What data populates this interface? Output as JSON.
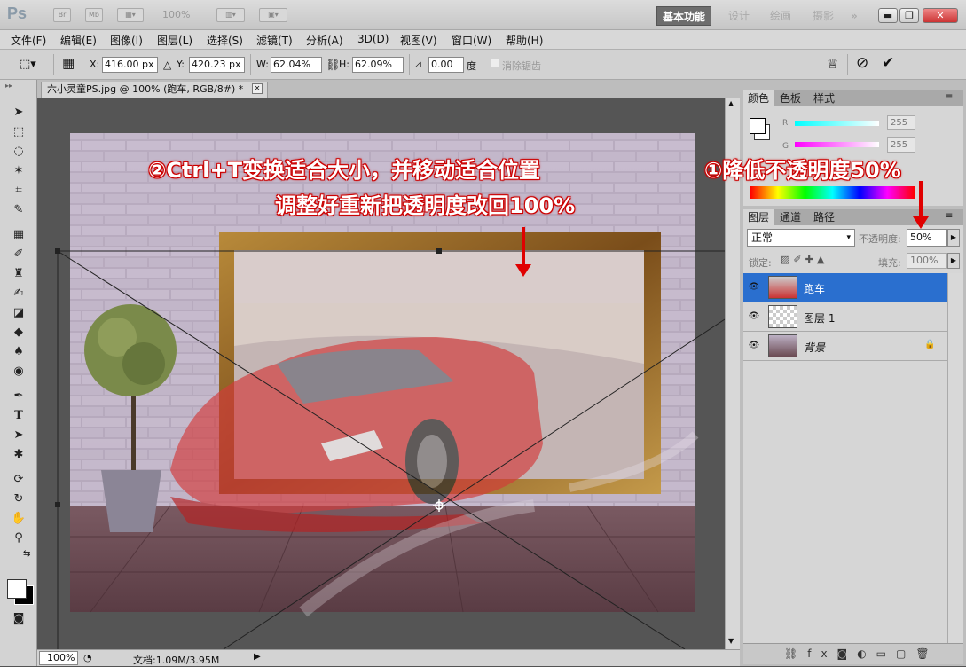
{
  "app": {
    "logo": "Ps",
    "br": "Br",
    "mb": "Mb",
    "zoom_preset": "100%"
  },
  "workspaces": [
    "基本功能",
    "设计",
    "绘画",
    "摄影",
    "»"
  ],
  "window_controls": {
    "minimize": "▬",
    "restore": "❐",
    "close": "✕"
  },
  "menus": [
    "文件(F)",
    "编辑(E)",
    "图像(I)",
    "图层(L)",
    "选择(S)",
    "滤镜(T)",
    "分析(A)",
    "3D(D)",
    "视图(V)",
    "窗口(W)",
    "帮助(H)"
  ],
  "options": {
    "x_label": "X:",
    "x_value": "416.00 px",
    "y_label": "Y:",
    "y_value": "420.23 px",
    "w_label": "W:",
    "w_value": "62.04%",
    "h_label": "H:",
    "h_value": "62.09%",
    "angle_value": "0.00",
    "angle_unit": "度",
    "antialias_label": "消除锯齿"
  },
  "document": {
    "tab_title": "六小灵童PS.jpg @ 100% (跑车, RGB/8#) *",
    "close": "✕"
  },
  "annotations": {
    "step2_line1": "②Ctrl+T变换适合大小，并移动适合位置",
    "step2_line2": "调整好重新把透明度改回100%",
    "step1": "①降低不透明度50%"
  },
  "status": {
    "zoom": "100%",
    "doc_info": "文档:1.09M/3.95M"
  },
  "color_panel": {
    "tabs": [
      "颜色",
      "色板",
      "样式"
    ],
    "r_label": "R",
    "r_value": "255",
    "g_label": "G",
    "g_value": "255"
  },
  "layers_panel": {
    "tabs": [
      "图层",
      "通道",
      "路径"
    ],
    "blend_mode": "正常",
    "opacity_label": "不透明度:",
    "opacity_value": "50%",
    "lock_label": "锁定:",
    "fill_label": "填充:",
    "fill_value": "100%",
    "layers": [
      {
        "name": "跑车",
        "selected": true
      },
      {
        "name": "图层 1",
        "selected": false
      },
      {
        "name": "背景",
        "selected": false
      }
    ]
  }
}
